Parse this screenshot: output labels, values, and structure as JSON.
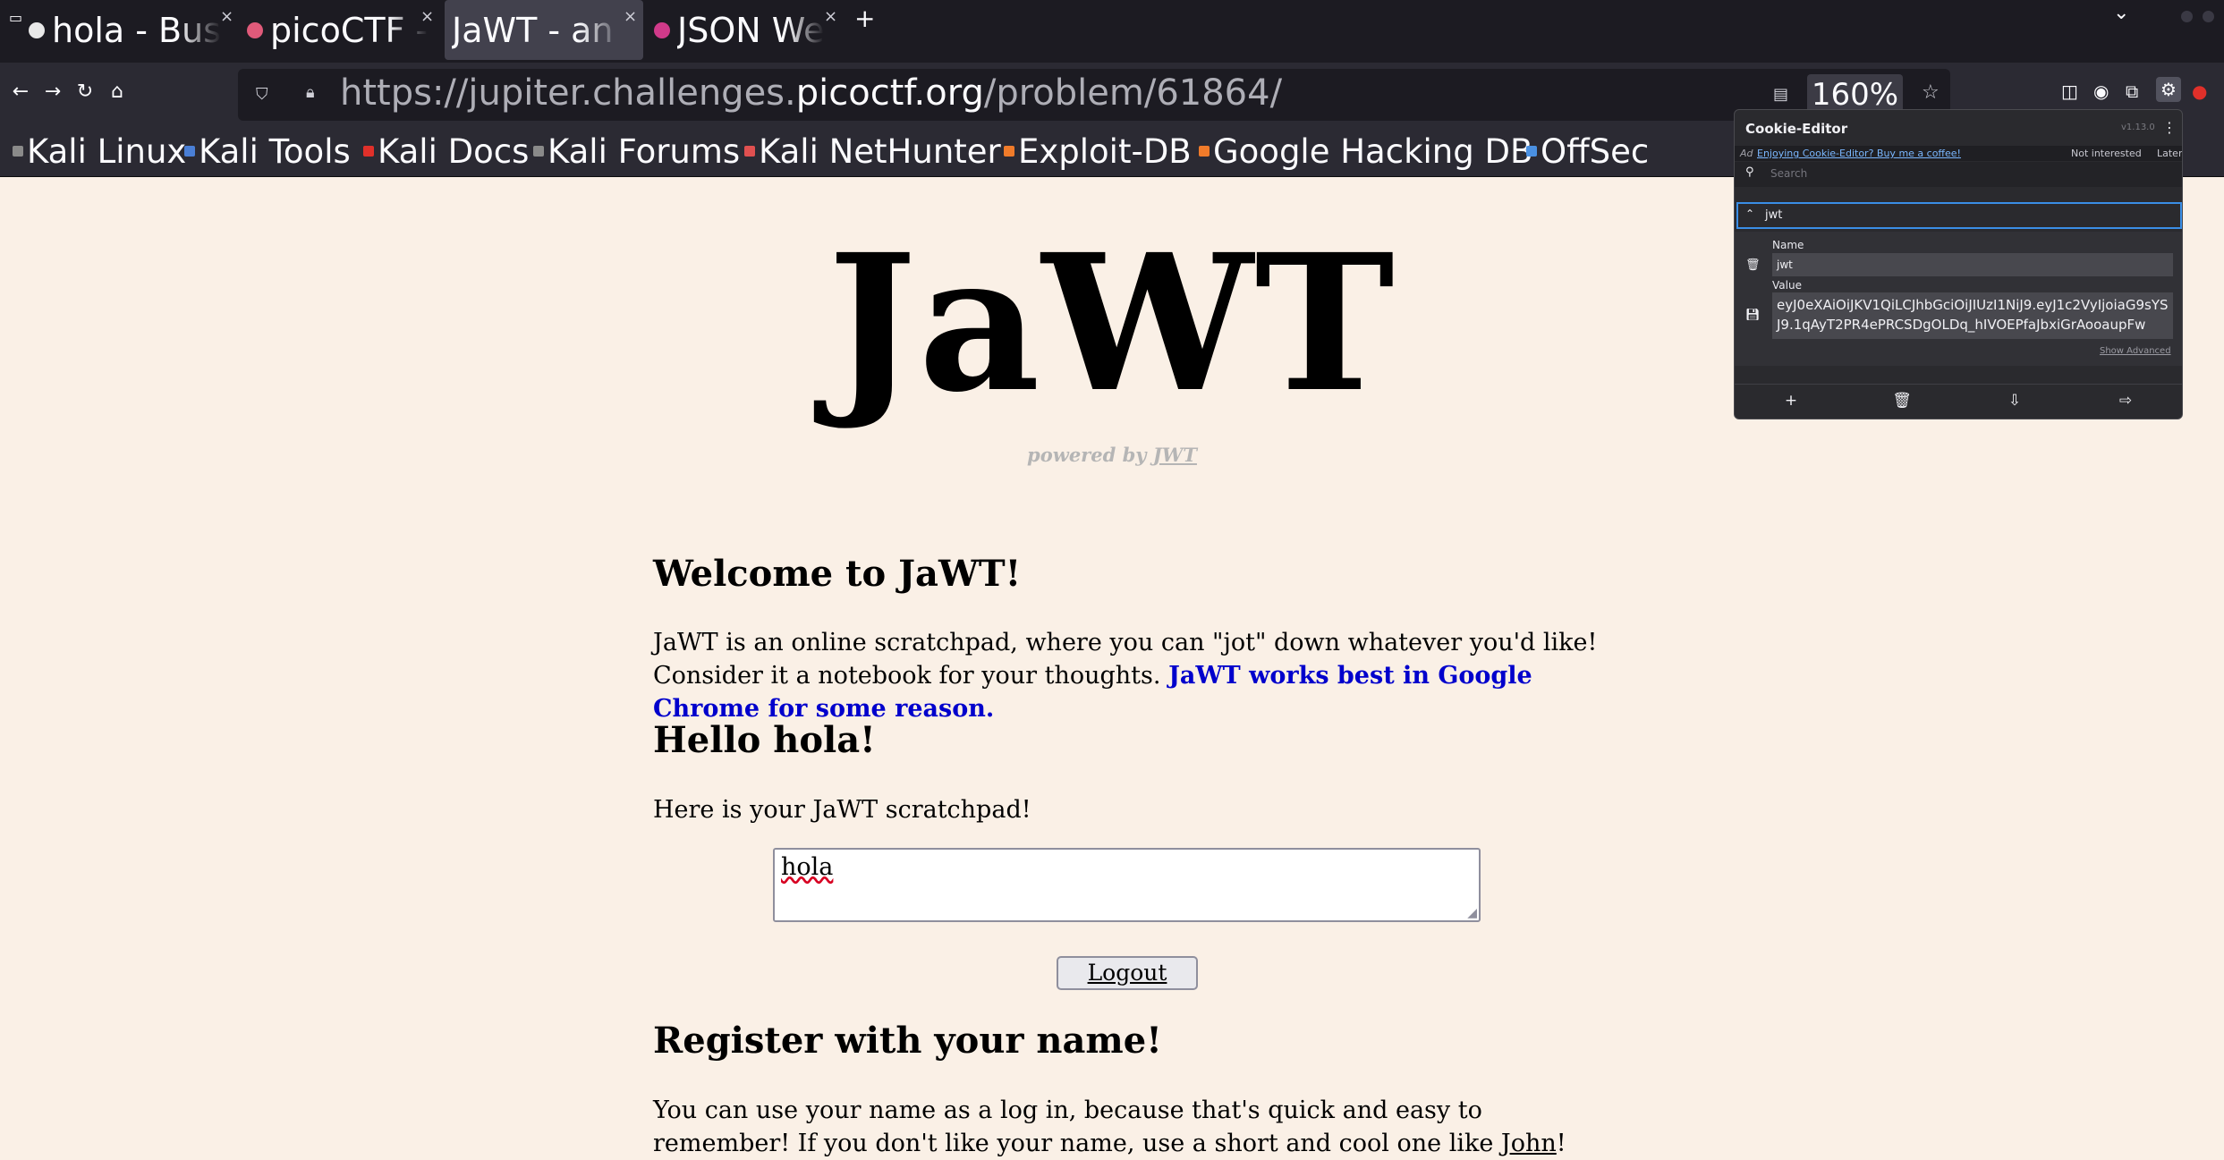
{
  "browser": {
    "tabs": [
      {
        "title": "hola - Bus",
        "favicon_color": "#e8e8e8",
        "active": false
      },
      {
        "title": "picoCTF - ",
        "favicon_color": "#e05a7a",
        "active": false
      },
      {
        "title": "JaWT - an o",
        "favicon_color": "",
        "active": true
      },
      {
        "title": "JSON We",
        "favicon_color": "#d03a8a",
        "active": false
      }
    ],
    "tab_close_glyph": "×",
    "new_tab_glyph": "+",
    "tab_list_glyph": "⌄",
    "url": {
      "prefix": "https://jupiter.challenges.",
      "host": "picoctf.org",
      "path": "/problem/61864/"
    },
    "zoom": "160%",
    "bookmarks": [
      {
        "label": "Kali Linux",
        "icon_color": "#8a8a8a"
      },
      {
        "label": "Kali Tools",
        "icon_color": "#4a7fd6"
      },
      {
        "label": "Kali Docs",
        "icon_color": "#e0302a"
      },
      {
        "label": "Kali Forums",
        "icon_color": "#8a8a8a"
      },
      {
        "label": "Kali NetHunter",
        "icon_color": "#e05050"
      },
      {
        "label": "Exploit-DB",
        "icon_color": "#f07b2a"
      },
      {
        "label": "Google Hacking DB",
        "icon_color": "#f07b2a"
      },
      {
        "label": "OffSec",
        "icon_color": "#4a90e2"
      }
    ]
  },
  "page": {
    "logo": "JaWT",
    "powered_prefix": "powered by ",
    "powered_link": "JWT",
    "welcome_heading": "Welcome to JaWT!",
    "welcome_text": " JaWT is an online scratchpad, where you can \"jot\" down whatever you'd like! Consider it a notebook for your thoughts. ",
    "welcome_highlight": "JaWT works best in Google Chrome for some reason.",
    "hello_heading": "Hello hola!",
    "scratchpad_intro": " Here is your JaWT scratchpad!",
    "scratchpad_value": "hola",
    "logout_label": "Logout",
    "register_heading": "Register with your name!",
    "register_text": " You can use your name as a log in, because that's quick and easy to remember! If you don't like your name, use a short and cool one like ",
    "register_example": "John",
    "register_end": "!"
  },
  "cookie_editor": {
    "title": "Cookie-Editor",
    "version": "v1.13.0",
    "ad_tag": "Ad",
    "ad_text": "Enjoying Cookie-Editor? Buy me a coffee!",
    "not_interested": "Not interested",
    "later": "Later",
    "search_placeholder": "Search",
    "cookie_name": "jwt",
    "name_label": "Name",
    "name_value": "jwt",
    "value_label": "Value",
    "value": "eyJ0eXAiOiJKV1QiLCJhbGciOiJIUzI1NiJ9.eyJ1c2VyIjoiaG9sYSJ9.1qAyT2PR4ePRCSDgOLDq_hIVOEPfaJbxiGrAooaupFw",
    "show_advanced": "Show Advanced"
  }
}
